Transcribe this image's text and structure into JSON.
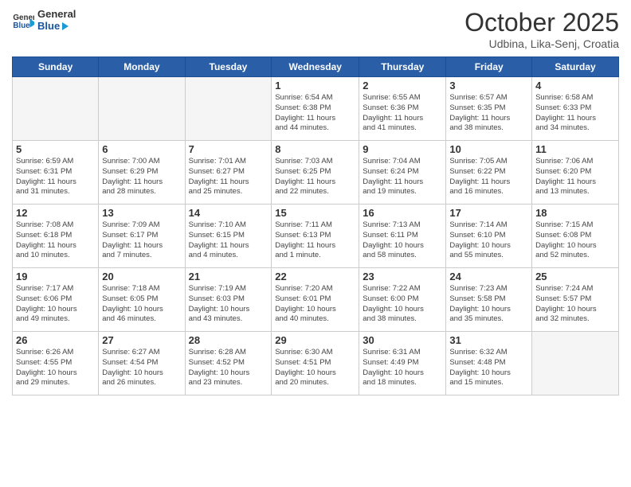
{
  "header": {
    "logo_general": "General",
    "logo_blue": "Blue",
    "month_title": "October 2025",
    "subtitle": "Udbina, Lika-Senj, Croatia"
  },
  "weekdays": [
    "Sunday",
    "Monday",
    "Tuesday",
    "Wednesday",
    "Thursday",
    "Friday",
    "Saturday"
  ],
  "weeks": [
    [
      {
        "day": "",
        "info": ""
      },
      {
        "day": "",
        "info": ""
      },
      {
        "day": "",
        "info": ""
      },
      {
        "day": "1",
        "info": "Sunrise: 6:54 AM\nSunset: 6:38 PM\nDaylight: 11 hours\nand 44 minutes."
      },
      {
        "day": "2",
        "info": "Sunrise: 6:55 AM\nSunset: 6:36 PM\nDaylight: 11 hours\nand 41 minutes."
      },
      {
        "day": "3",
        "info": "Sunrise: 6:57 AM\nSunset: 6:35 PM\nDaylight: 11 hours\nand 38 minutes."
      },
      {
        "day": "4",
        "info": "Sunrise: 6:58 AM\nSunset: 6:33 PM\nDaylight: 11 hours\nand 34 minutes."
      }
    ],
    [
      {
        "day": "5",
        "info": "Sunrise: 6:59 AM\nSunset: 6:31 PM\nDaylight: 11 hours\nand 31 minutes."
      },
      {
        "day": "6",
        "info": "Sunrise: 7:00 AM\nSunset: 6:29 PM\nDaylight: 11 hours\nand 28 minutes."
      },
      {
        "day": "7",
        "info": "Sunrise: 7:01 AM\nSunset: 6:27 PM\nDaylight: 11 hours\nand 25 minutes."
      },
      {
        "day": "8",
        "info": "Sunrise: 7:03 AM\nSunset: 6:25 PM\nDaylight: 11 hours\nand 22 minutes."
      },
      {
        "day": "9",
        "info": "Sunrise: 7:04 AM\nSunset: 6:24 PM\nDaylight: 11 hours\nand 19 minutes."
      },
      {
        "day": "10",
        "info": "Sunrise: 7:05 AM\nSunset: 6:22 PM\nDaylight: 11 hours\nand 16 minutes."
      },
      {
        "day": "11",
        "info": "Sunrise: 7:06 AM\nSunset: 6:20 PM\nDaylight: 11 hours\nand 13 minutes."
      }
    ],
    [
      {
        "day": "12",
        "info": "Sunrise: 7:08 AM\nSunset: 6:18 PM\nDaylight: 11 hours\nand 10 minutes."
      },
      {
        "day": "13",
        "info": "Sunrise: 7:09 AM\nSunset: 6:17 PM\nDaylight: 11 hours\nand 7 minutes."
      },
      {
        "day": "14",
        "info": "Sunrise: 7:10 AM\nSunset: 6:15 PM\nDaylight: 11 hours\nand 4 minutes."
      },
      {
        "day": "15",
        "info": "Sunrise: 7:11 AM\nSunset: 6:13 PM\nDaylight: 11 hours\nand 1 minute."
      },
      {
        "day": "16",
        "info": "Sunrise: 7:13 AM\nSunset: 6:11 PM\nDaylight: 10 hours\nand 58 minutes."
      },
      {
        "day": "17",
        "info": "Sunrise: 7:14 AM\nSunset: 6:10 PM\nDaylight: 10 hours\nand 55 minutes."
      },
      {
        "day": "18",
        "info": "Sunrise: 7:15 AM\nSunset: 6:08 PM\nDaylight: 10 hours\nand 52 minutes."
      }
    ],
    [
      {
        "day": "19",
        "info": "Sunrise: 7:17 AM\nSunset: 6:06 PM\nDaylight: 10 hours\nand 49 minutes."
      },
      {
        "day": "20",
        "info": "Sunrise: 7:18 AM\nSunset: 6:05 PM\nDaylight: 10 hours\nand 46 minutes."
      },
      {
        "day": "21",
        "info": "Sunrise: 7:19 AM\nSunset: 6:03 PM\nDaylight: 10 hours\nand 43 minutes."
      },
      {
        "day": "22",
        "info": "Sunrise: 7:20 AM\nSunset: 6:01 PM\nDaylight: 10 hours\nand 40 minutes."
      },
      {
        "day": "23",
        "info": "Sunrise: 7:22 AM\nSunset: 6:00 PM\nDaylight: 10 hours\nand 38 minutes."
      },
      {
        "day": "24",
        "info": "Sunrise: 7:23 AM\nSunset: 5:58 PM\nDaylight: 10 hours\nand 35 minutes."
      },
      {
        "day": "25",
        "info": "Sunrise: 7:24 AM\nSunset: 5:57 PM\nDaylight: 10 hours\nand 32 minutes."
      }
    ],
    [
      {
        "day": "26",
        "info": "Sunrise: 6:26 AM\nSunset: 4:55 PM\nDaylight: 10 hours\nand 29 minutes."
      },
      {
        "day": "27",
        "info": "Sunrise: 6:27 AM\nSunset: 4:54 PM\nDaylight: 10 hours\nand 26 minutes."
      },
      {
        "day": "28",
        "info": "Sunrise: 6:28 AM\nSunset: 4:52 PM\nDaylight: 10 hours\nand 23 minutes."
      },
      {
        "day": "29",
        "info": "Sunrise: 6:30 AM\nSunset: 4:51 PM\nDaylight: 10 hours\nand 20 minutes."
      },
      {
        "day": "30",
        "info": "Sunrise: 6:31 AM\nSunset: 4:49 PM\nDaylight: 10 hours\nand 18 minutes."
      },
      {
        "day": "31",
        "info": "Sunrise: 6:32 AM\nSunset: 4:48 PM\nDaylight: 10 hours\nand 15 minutes."
      },
      {
        "day": "",
        "info": ""
      }
    ]
  ]
}
